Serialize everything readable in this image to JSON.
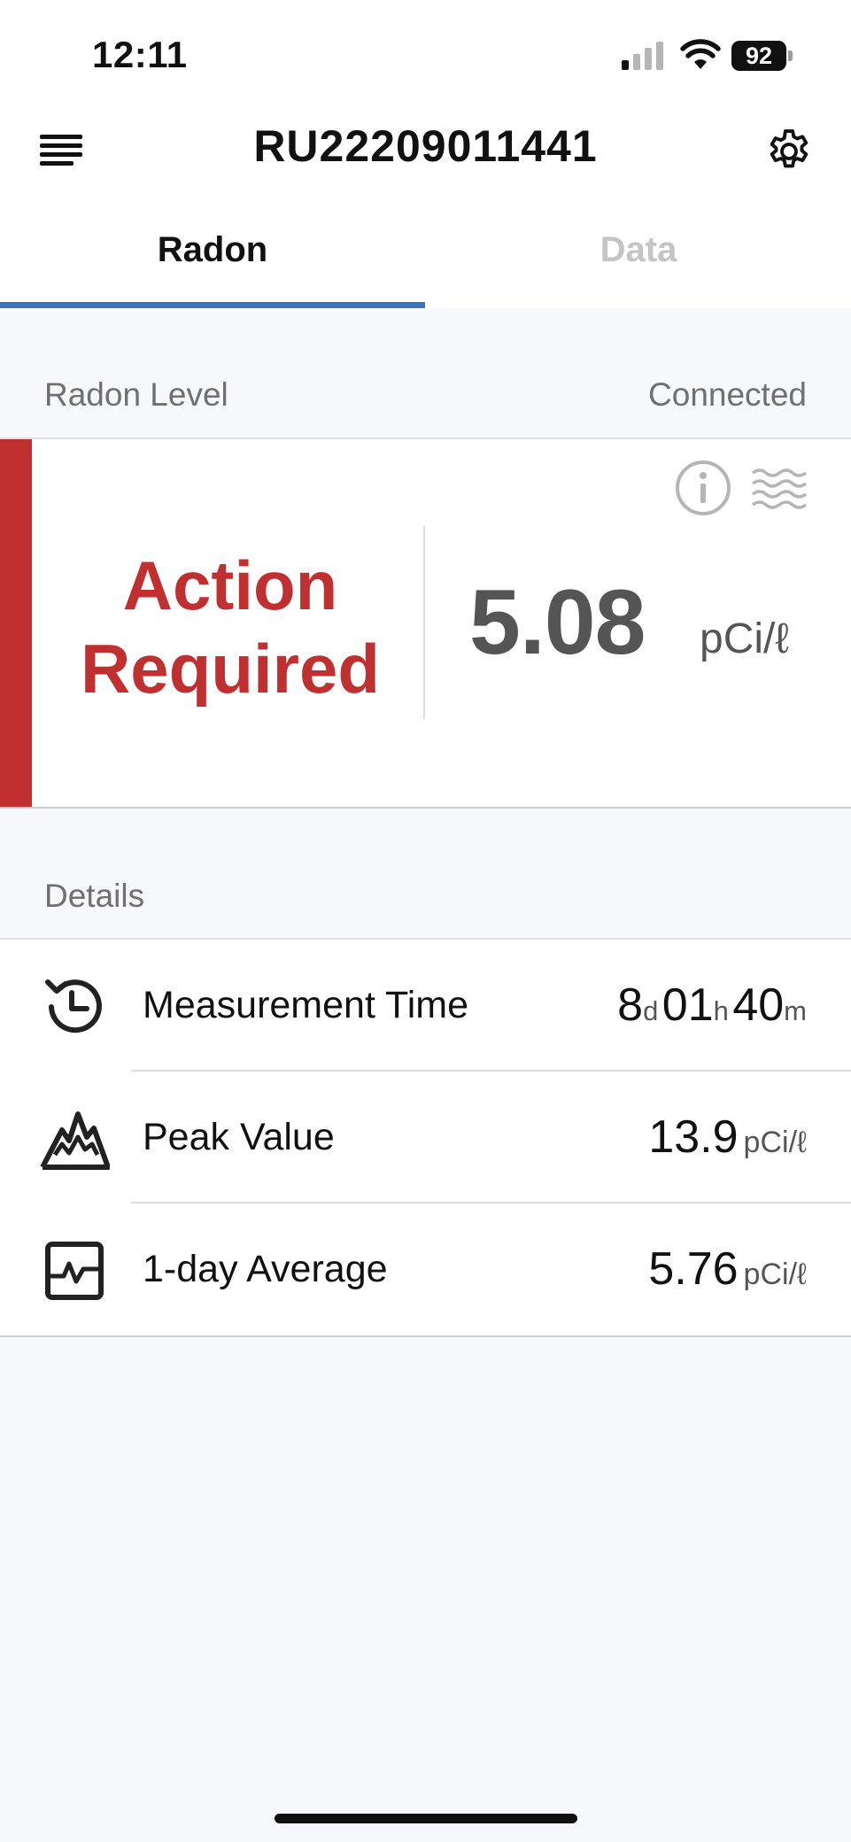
{
  "status_bar": {
    "time": "12:11",
    "battery": "92"
  },
  "header": {
    "title": "RU22209011441",
    "menu_icon": "menu-lines-icon",
    "settings_icon": "gear-icon"
  },
  "tabs": [
    {
      "label": "Radon",
      "active": true
    },
    {
      "label": "Data",
      "active": false
    }
  ],
  "radon_section": {
    "label": "Radon Level",
    "connection_status": "Connected",
    "status_line1": "Action",
    "status_line2": "Required",
    "value": "5.08",
    "unit": "pCi/ℓ",
    "status_color": "#c03030"
  },
  "details": {
    "label": "Details",
    "measurement_time": {
      "label": "Measurement Time",
      "days": "8",
      "days_unit": "d",
      "hours": "01",
      "hours_unit": "h",
      "minutes": "40",
      "minutes_unit": "m"
    },
    "peak_value": {
      "label": "Peak Value",
      "value": "13.9",
      "unit": "pCi/ℓ"
    },
    "one_day_average": {
      "label": "1-day Average",
      "value": "5.76",
      "unit": "pCi/ℓ"
    }
  },
  "colors": {
    "accent": "#3b74b8",
    "alert": "#c03030"
  }
}
